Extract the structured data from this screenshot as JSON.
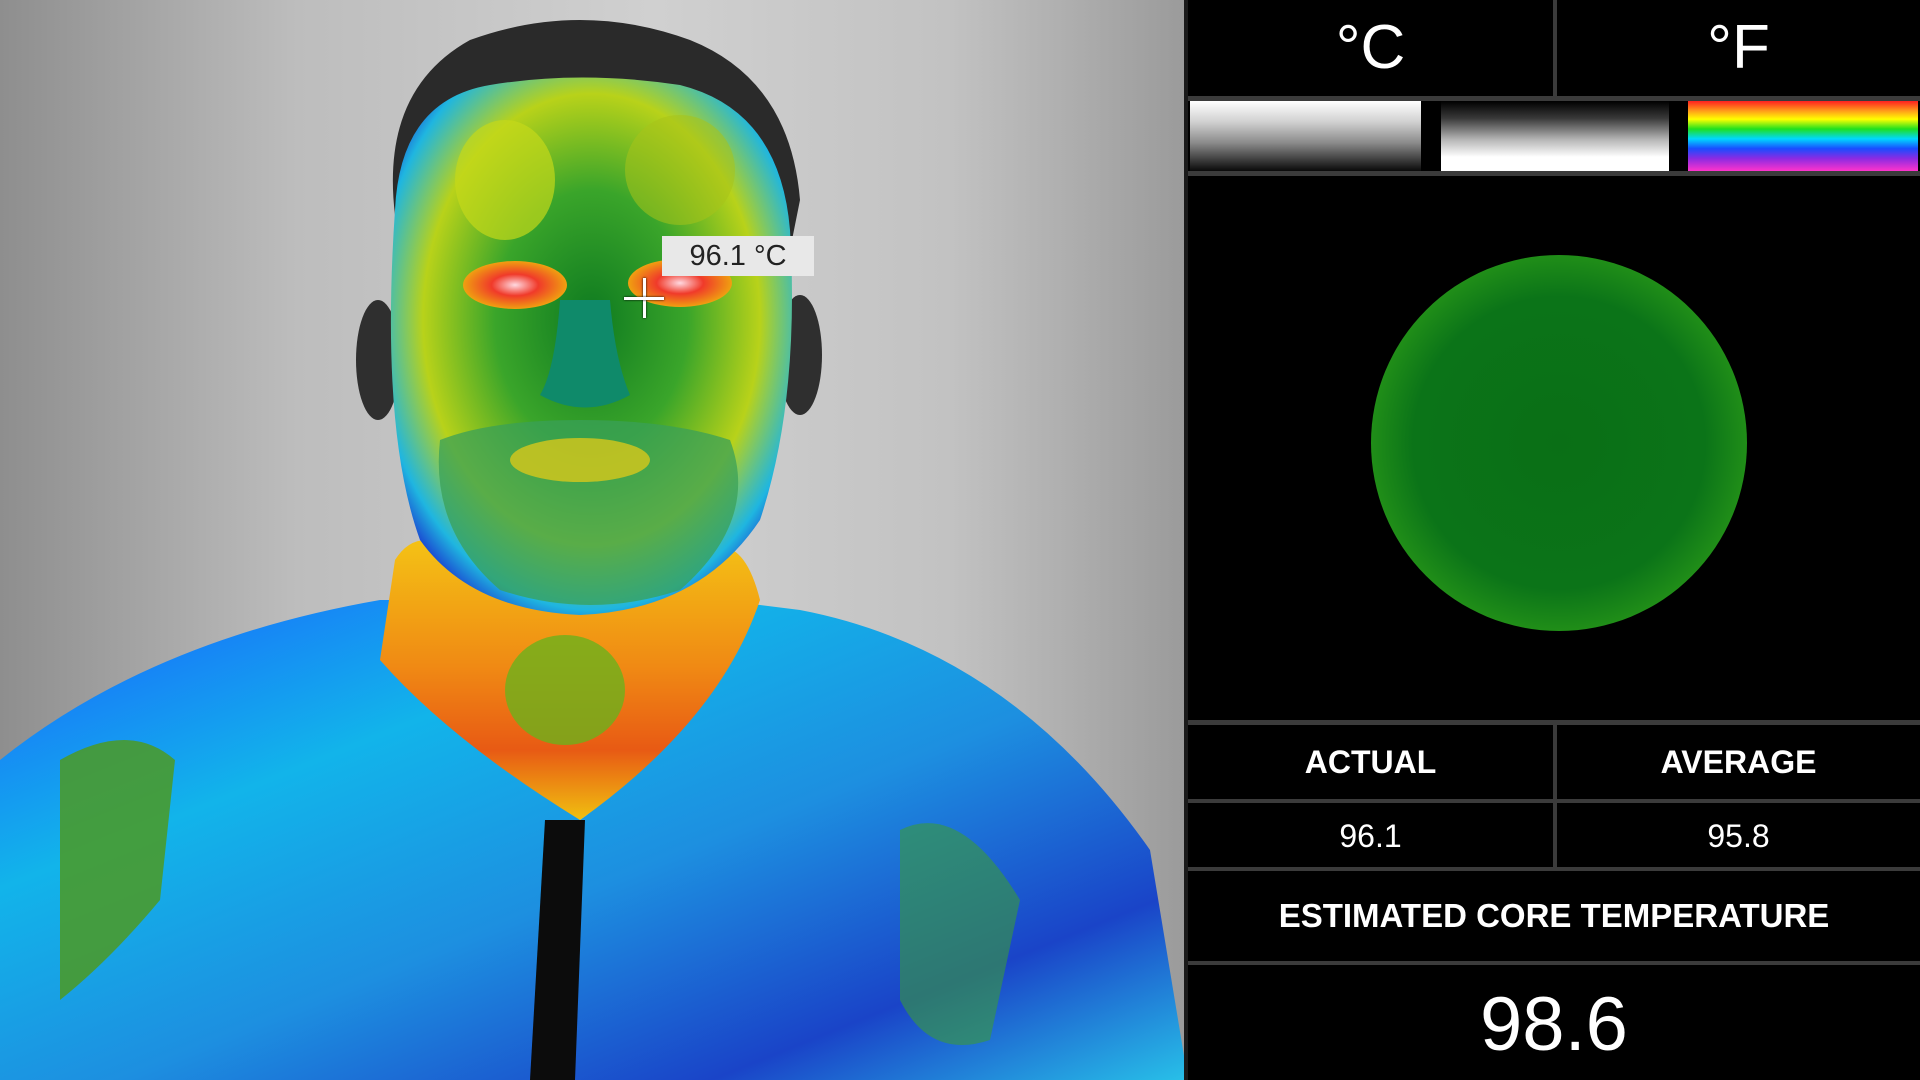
{
  "camera": {
    "readout": "96.1 °C",
    "crosshair_icon": "crosshair-icon"
  },
  "units": {
    "celsius": "°C",
    "fahrenheit": "°F"
  },
  "palettes": [
    {
      "name": "white-hot",
      "icon": "white-hot-palette-icon"
    },
    {
      "name": "black-hot",
      "icon": "black-hot-palette-icon"
    },
    {
      "name": "rainbow",
      "icon": "rainbow-palette-icon"
    }
  ],
  "status": {
    "color": "#0b7418",
    "glow_color": "#5cc21b"
  },
  "readings": {
    "actual_label": "ACTUAL",
    "average_label": "AVERAGE",
    "actual_value": "96.1",
    "average_value": "95.8",
    "core_label": "ESTIMATED CORE TEMPERATURE",
    "core_value": "98.6"
  }
}
